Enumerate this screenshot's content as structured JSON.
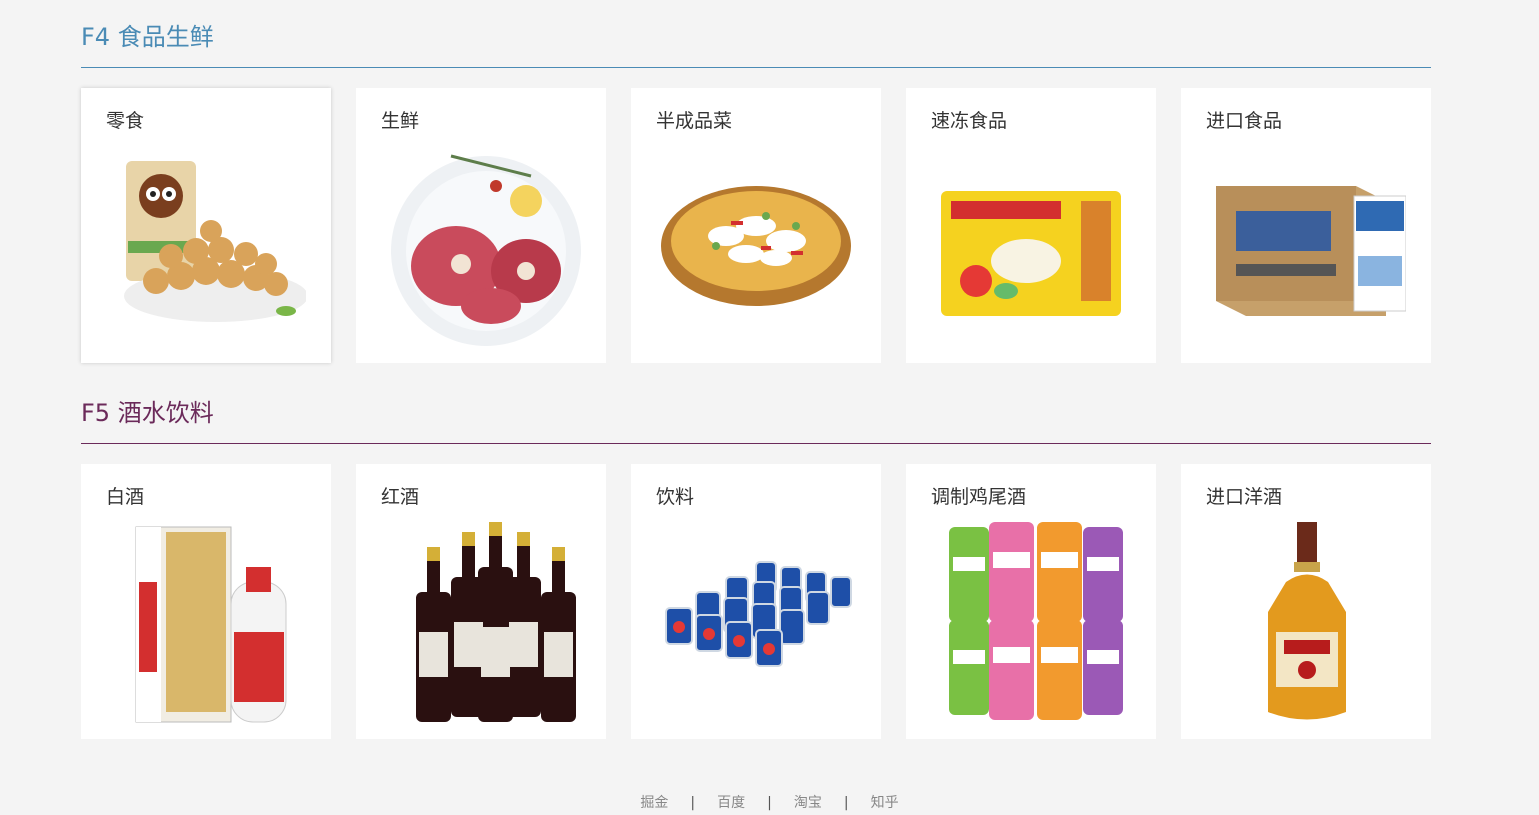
{
  "floors": [
    {
      "title": "F4 食品生鲜",
      "items": [
        {
          "label": "零食",
          "icon": "snack-image"
        },
        {
          "label": "生鲜",
          "icon": "fresh-meat-image"
        },
        {
          "label": "半成品菜",
          "icon": "prepared-dish-image"
        },
        {
          "label": "速冻食品",
          "icon": "frozen-dumplings-image"
        },
        {
          "label": "进口食品",
          "icon": "imported-milk-image"
        }
      ]
    },
    {
      "title": "F5 酒水饮料",
      "items": [
        {
          "label": "白酒",
          "icon": "baijiu-image"
        },
        {
          "label": "红酒",
          "icon": "red-wine-image"
        },
        {
          "label": "饮料",
          "icon": "soda-cans-image"
        },
        {
          "label": "调制鸡尾酒",
          "icon": "cocktail-cans-image"
        },
        {
          "label": "进口洋酒",
          "icon": "whisky-image"
        }
      ]
    }
  ],
  "footer": {
    "links": [
      "掘金",
      "百度",
      "淘宝",
      "知乎"
    ],
    "separator": "|"
  },
  "colors": {
    "f4_accent": "#4a8bb5",
    "f5_accent": "#6b2a5a",
    "background": "#f4f4f4"
  }
}
